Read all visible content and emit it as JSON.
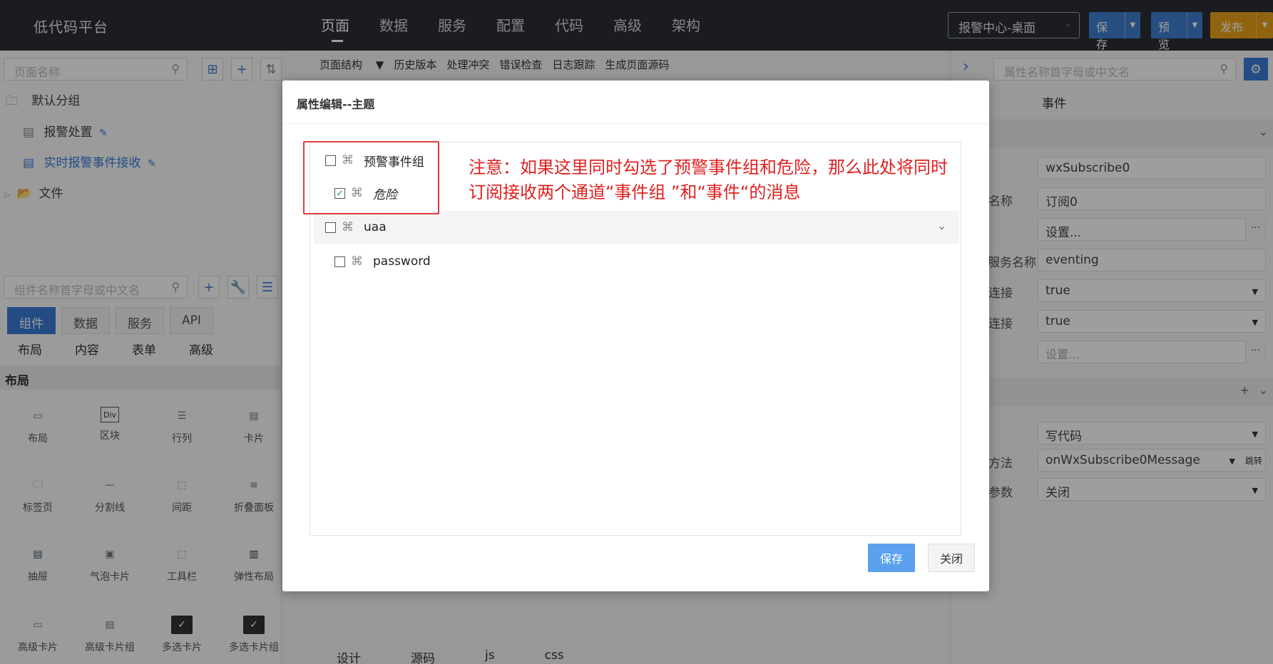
{
  "app": {
    "logo": "低代码平台"
  },
  "nav": [
    {
      "label": "页面",
      "active": true
    },
    {
      "label": "数据"
    },
    {
      "label": "服务"
    },
    {
      "label": "配置"
    },
    {
      "label": "代码"
    },
    {
      "label": "高级"
    },
    {
      "label": "架构"
    }
  ],
  "header": {
    "app_select": "报警中心-桌面",
    "save": "保存",
    "preview": "预览",
    "publish": "发布"
  },
  "left": {
    "page_search_placeholder": "页面名称",
    "tree": {
      "default_group": "默认分组",
      "item1": "报警处置",
      "item2": "实时报警事件接收",
      "files": "文件"
    },
    "comp_search_placeholder": "组件名称首字母或中文名",
    "tabs1": [
      "组件",
      "数据",
      "服务",
      "API"
    ],
    "tabs2": [
      "布局",
      "内容",
      "表单",
      "高级"
    ],
    "section": "布局",
    "components": [
      "布局",
      "区块",
      "行列",
      "卡片",
      "标签页",
      "分割线",
      "间距",
      "折叠面板",
      "抽屉",
      "气泡卡片",
      "工具栏",
      "弹性布局",
      "高级卡片",
      "高级卡片组",
      "多选卡片",
      "多选卡片组"
    ]
  },
  "center": {
    "toolbar": [
      "页面结构",
      "历史版本",
      "处理冲突",
      "错误检查",
      "日志跟踪",
      "生成页面源码"
    ],
    "bottom_tabs": [
      "设计",
      "源码",
      "js",
      "css"
    ]
  },
  "right": {
    "search_placeholder": "属性名称首字母或中文名",
    "tab_events": "事件",
    "fields": {
      "f1": "wxSubscribe0",
      "l2": "名称",
      "f2": "订阅0",
      "f3": "设置...",
      "l4": "服务名称",
      "f4": "eventing",
      "l5": "连接",
      "f5": "true",
      "l6": "连接",
      "f6": "true",
      "f7": "设置...",
      "f8": "写代码",
      "l9": "方法",
      "f9": "onWxSubscribe0Message",
      "jump": "跳转",
      "l10": "参数",
      "f10": "关闭"
    }
  },
  "dialog": {
    "title": "属性编辑--主题",
    "rows": {
      "group1": "预警事件组",
      "child1": "危险",
      "group2": "uaa",
      "child2": "password"
    },
    "note_line1": "注意：如果这里同时勾选了预警事件组和危险，那么此处将同时",
    "note_line2": "订阅接收两个通道“事件组 ”和“事件“的消息",
    "save": "保存",
    "close": "关闭"
  }
}
